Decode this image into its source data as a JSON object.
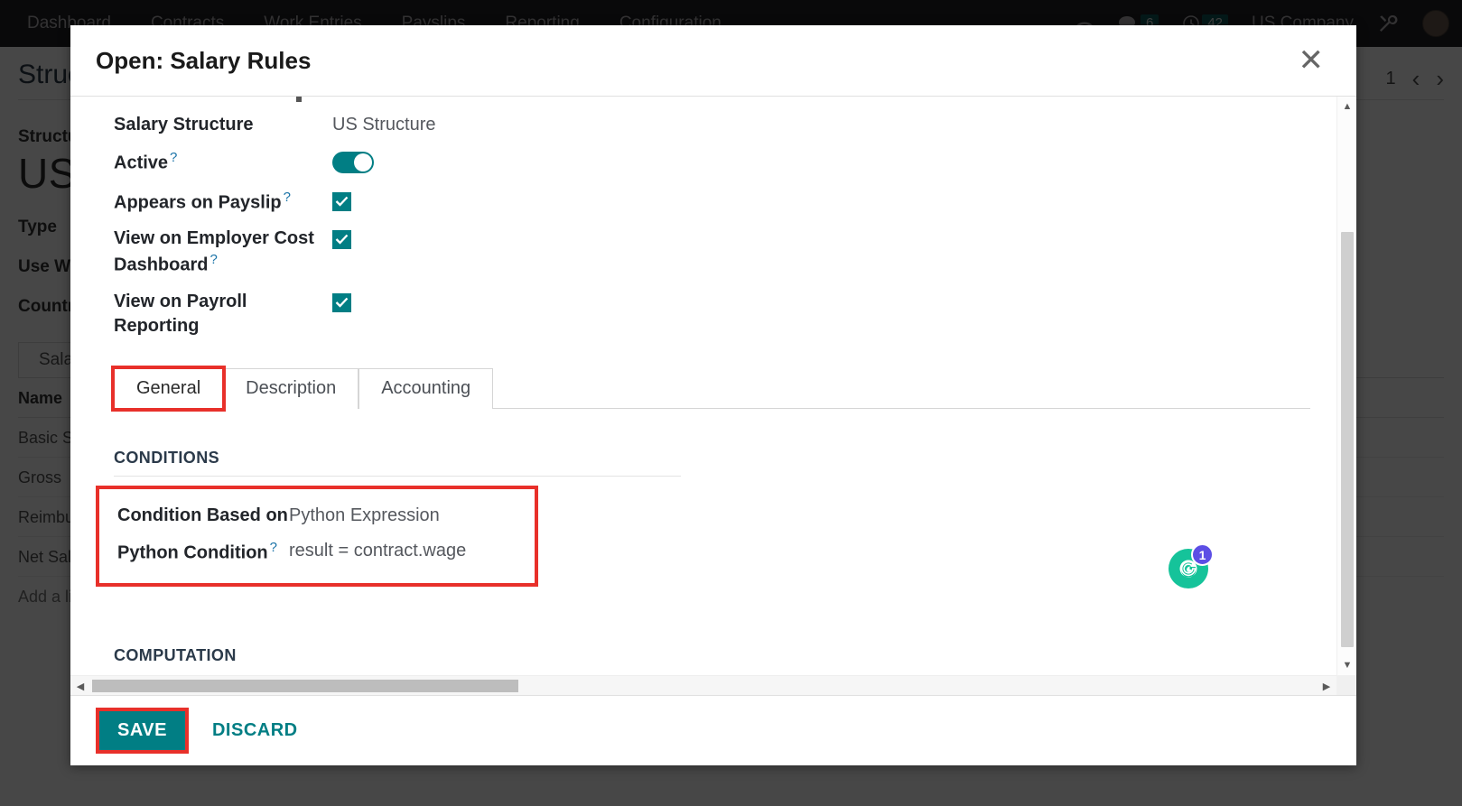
{
  "topbar": {
    "menu": [
      {
        "label": "Dashboard"
      },
      {
        "label": "Contracts"
      },
      {
        "label": "Work Entries"
      },
      {
        "label": "Payslips"
      },
      {
        "label": "Reporting"
      },
      {
        "label": "Configuration"
      }
    ],
    "messages_count": "6",
    "activities_count": "42",
    "company": "US Company"
  },
  "background": {
    "breadcrumb": "Structures",
    "pager": "1",
    "structure_label": "Structure",
    "structure_name": "US",
    "type_label": "Type",
    "use_worked_label": "Use Worked Days",
    "country_label": "Country",
    "tab_label": "Salary Rules",
    "table": {
      "header": "Name",
      "rows": [
        "Basic Salary",
        "Gross",
        "Reimbursement",
        "Net Salary"
      ],
      "add_line": "Add a line"
    }
  },
  "modal": {
    "title": "Open: Salary Rules",
    "close_label": "✕",
    "fields": [
      {
        "label": "Salary Structure",
        "value": "US Structure",
        "type": "text",
        "help": false
      },
      {
        "label": "Active",
        "value": "",
        "type": "toggle",
        "help": true
      },
      {
        "label": "Appears on Payslip",
        "value": "",
        "type": "checkbox",
        "help": true
      },
      {
        "label": "View on Employer Cost Dashboard",
        "value": "",
        "type": "checkbox",
        "help": true
      },
      {
        "label": "View on Payroll Reporting",
        "value": "",
        "type": "checkbox",
        "help": false
      }
    ],
    "tabs": [
      {
        "label": "General",
        "active": true,
        "highlighted": true
      },
      {
        "label": "Description",
        "active": false,
        "highlighted": false
      },
      {
        "label": "Accounting",
        "active": false,
        "highlighted": false
      }
    ],
    "conditions": {
      "section_title": "CONDITIONS",
      "based_on_label": "Condition Based on",
      "based_on_value": "Python Expression",
      "python_label": "Python Condition",
      "python_value": "result = contract.wage"
    },
    "computation": {
      "section_title": "COMPUTATION"
    },
    "footer": {
      "save_label": "SAVE",
      "discard_label": "DISCARD"
    },
    "scroll": {
      "up_arrow": "▲",
      "down_arrow": "▼",
      "left_arrow": "◀",
      "right_arrow": "▶"
    }
  },
  "grammarly": {
    "letter": "G",
    "badge": "1"
  },
  "colors": {
    "accent": "#017e84",
    "highlight": "#e8302a",
    "topbar": "#222126",
    "grammarly_green": "#15c39a",
    "grammarly_purple": "#5c4ee5"
  }
}
